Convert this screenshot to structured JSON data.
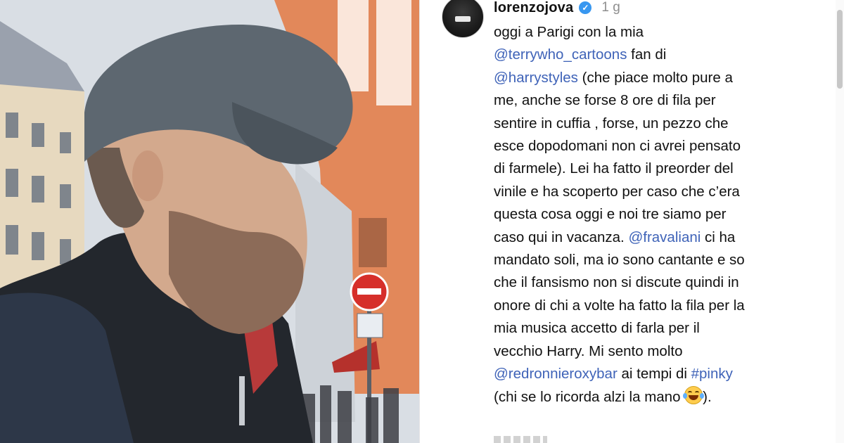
{
  "photo": {
    "description_icons": [
      "stop-sign-icon"
    ],
    "sign_text": "",
    "subplate_text": ""
  },
  "post": {
    "username": "lorenzojova",
    "verified_icon": "verified-badge-icon",
    "time": "1 g",
    "caption": [
      {
        "t": "oggi a Parigi con la mia\n"
      },
      {
        "t": "@terrywho_cartoons",
        "m": true
      },
      {
        "t": " fan di\n"
      },
      {
        "t": "@harrystyles",
        "m": true
      },
      {
        "t": " (che piace molto pure a\nme, anche se forse 8 ore di fila per\nsentire in cuffia , forse, un pezzo che\nesce dopodomani non ci avrei pensato\ndi farmele). Lei ha fatto il preorder del\nvinile e ha scoperto per caso che c’era\nquesta cosa oggi e noi tre siamo per\ncaso qui in vacanza. "
      },
      {
        "t": "@fravaliani",
        "m": true
      },
      {
        "t": " ci ha\nmandato soli, ma io sono cantante e so\nche il fansismo non si discute quindi in\nonore di chi a volte ha fatto la fila per la\nmia musica accetto di farla per il\nvecchio Harry. Mi sento molto\n"
      },
      {
        "t": "@redronnieroxybar",
        "m": true
      },
      {
        "t": " ai tempi di "
      },
      {
        "t": "#pinky",
        "m": true
      },
      {
        "t": "\n(chi se lo ricorda alzi la mano "
      },
      {
        "emoji": "laughing-tears-emoji"
      },
      {
        "t": ")."
      }
    ]
  },
  "colors": {
    "mention": "#3f63b8",
    "verified": "#3897f0",
    "text": "#111111",
    "muted": "#8e8e8e"
  }
}
